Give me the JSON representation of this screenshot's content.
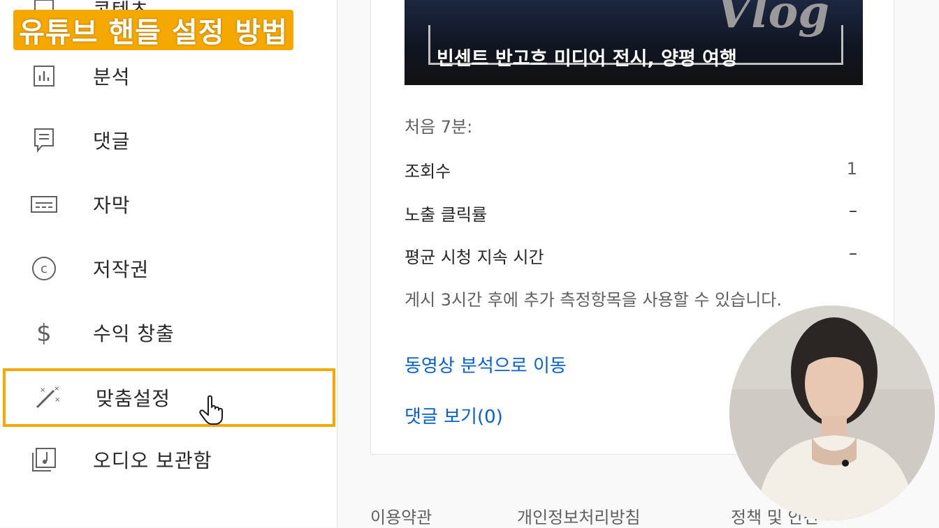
{
  "overlay_title": "유튜브 핸들 설정 방법",
  "sidebar": {
    "items": [
      {
        "label": "콘텐츠",
        "icon": "content-icon"
      },
      {
        "label": "분석",
        "icon": "analytics-icon"
      },
      {
        "label": "댓글",
        "icon": "comments-icon"
      },
      {
        "label": "자막",
        "icon": "subtitles-icon"
      },
      {
        "label": "저작권",
        "icon": "copyright-icon"
      },
      {
        "label": "수익 창출",
        "icon": "dollar-icon"
      },
      {
        "label": "맞춤설정",
        "icon": "magic-wand-icon"
      },
      {
        "label": "오디오 보관함",
        "icon": "audio-library-icon"
      }
    ]
  },
  "thumbnail": {
    "caption": "빈센트 반고흐 미디어 전시, 양평 여행",
    "brand": "Vlog"
  },
  "stats": {
    "heading": "처음 7분:",
    "rows": [
      {
        "label": "조회수",
        "value": "1"
      },
      {
        "label": "노출 클릭률",
        "value": "–"
      },
      {
        "label": "평균 시청 지속 시간",
        "value": "–"
      }
    ],
    "note": "게시 3시간 후에 추가 측정항목을 사용할 수 있습니다."
  },
  "links": {
    "analytics": "동영상 분석으로 이동",
    "comments": "댓글 보기(0)"
  },
  "footer": {
    "terms": "이용약관",
    "privacy": "개인정보처리방침",
    "policy": "정책 및 안전"
  },
  "colors": {
    "highlight": "#f5a800",
    "link": "#065fd4"
  }
}
